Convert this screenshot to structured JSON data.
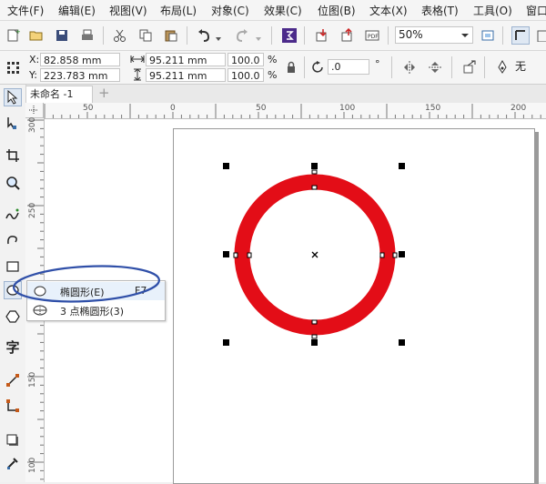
{
  "menu": {
    "items": [
      "文件(F)",
      "编辑(E)",
      "视图(V)",
      "布局(L)",
      "对象(C)",
      "效果(C)",
      "位图(B)",
      "文本(X)",
      "表格(T)",
      "工具(O)",
      "窗口"
    ]
  },
  "toolbar": {
    "zoom_value": "50%"
  },
  "propbar": {
    "x_label": "X:",
    "x_value": "82.858 mm",
    "y_label": "Y:",
    "y_value": "223.783 mm",
    "w_value": "95.211 mm",
    "h_value": "95.211 mm",
    "scale_w": "100.0",
    "scale_h": "100.0",
    "percent": "%",
    "rotation": ".0",
    "degree": "°",
    "outline_none": "无"
  },
  "document": {
    "tab_title": "未命名 -1",
    "add_tab": "+"
  },
  "ruler": {
    "h_ticks": [
      "50",
      "0",
      "50",
      "100",
      "150",
      "200"
    ],
    "v_ticks": [
      "300",
      "250",
      "200",
      "150",
      "100"
    ]
  },
  "flyout": {
    "items": [
      {
        "label": "椭圆形(E)",
        "shortcut": "F7"
      },
      {
        "label": "3 点椭圆形(3)",
        "shortcut": ""
      }
    ]
  },
  "toolbox": {
    "text_tool_glyph": "字"
  },
  "colors": {
    "circle_stroke": "#e30d17",
    "annotation": "#2f4fa8"
  }
}
